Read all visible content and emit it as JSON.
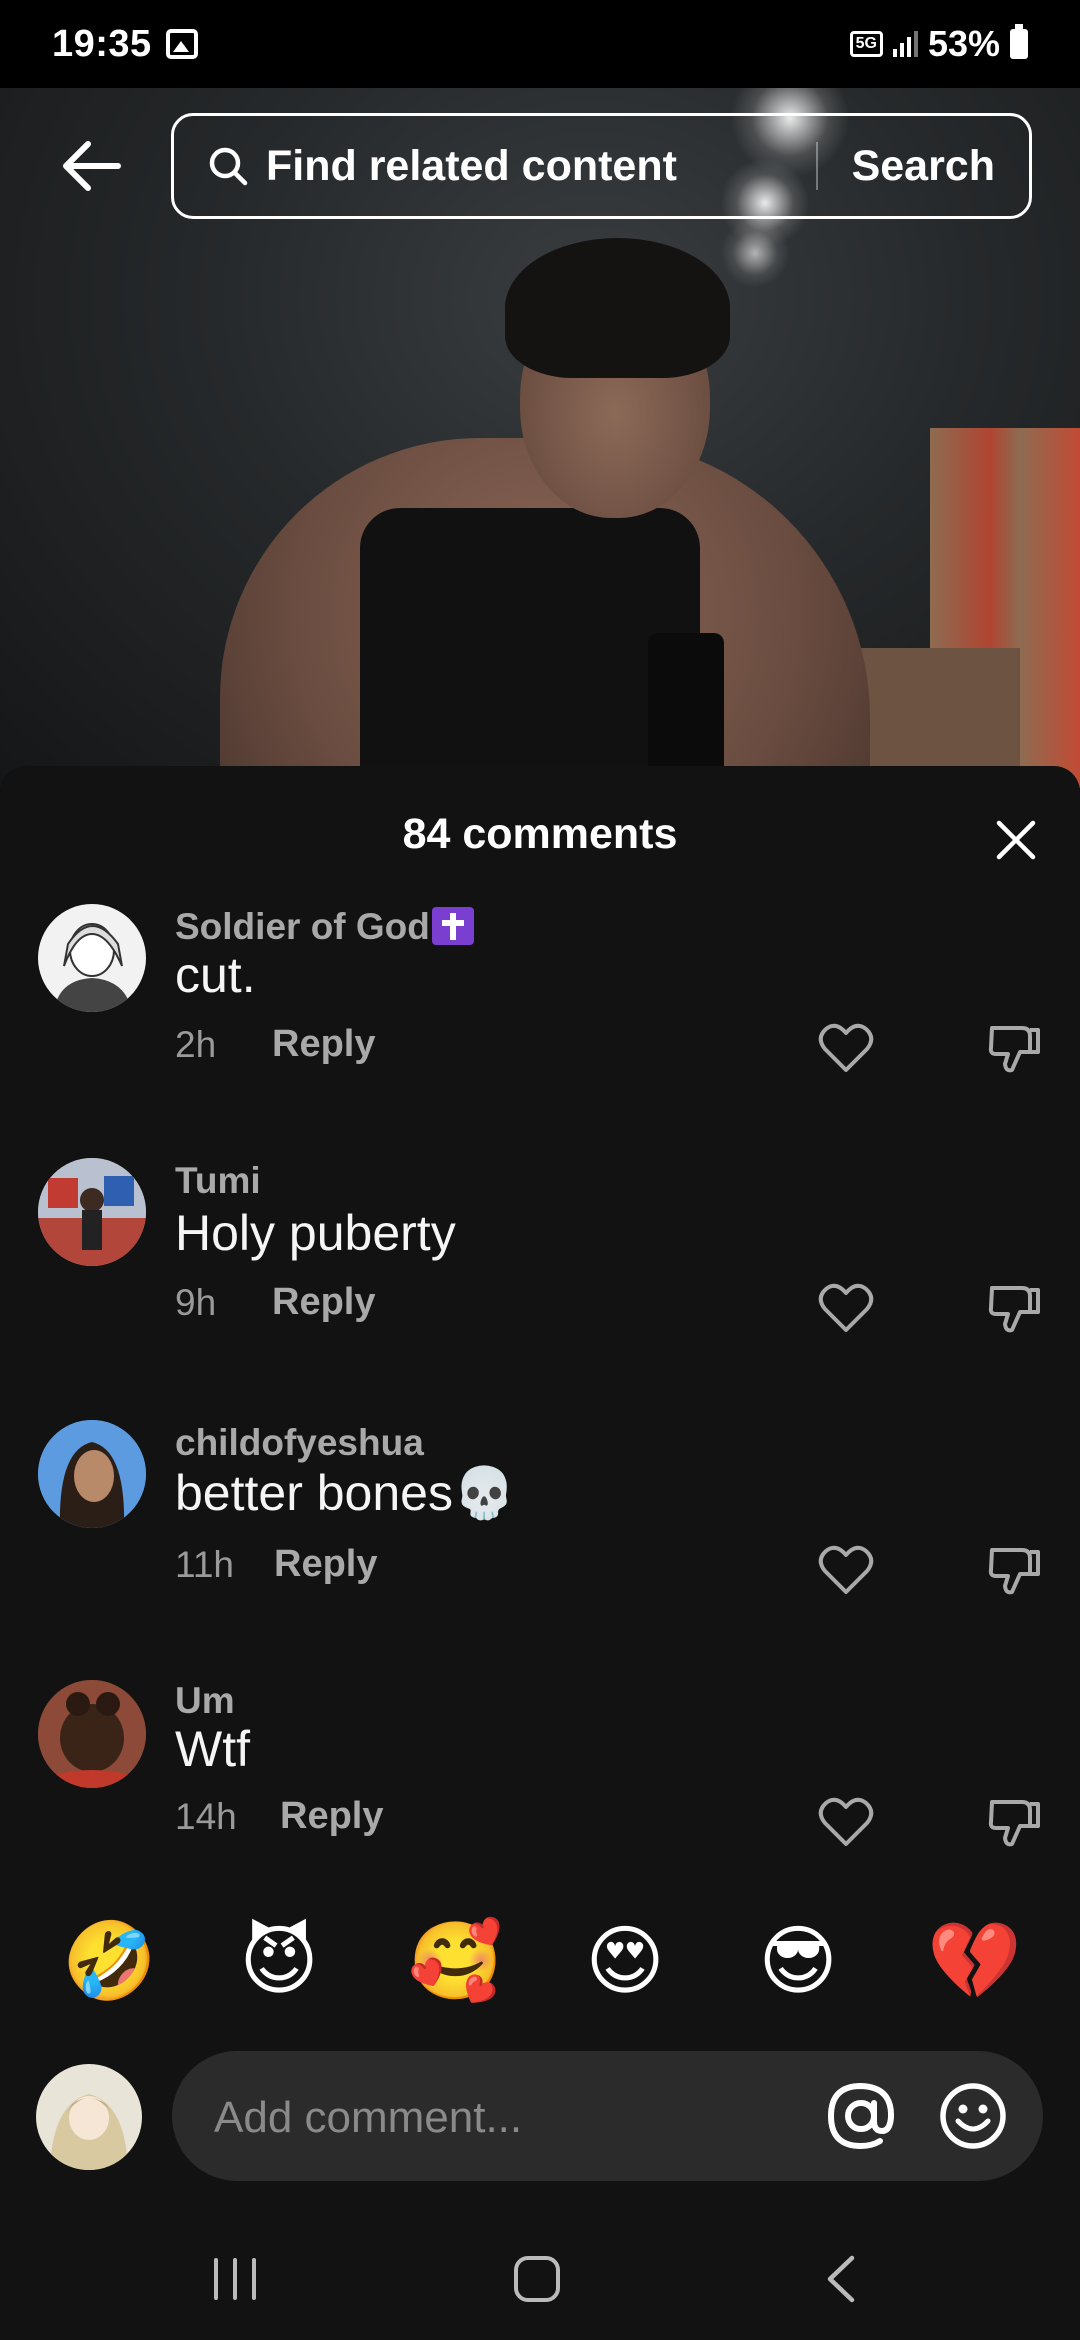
{
  "status_bar": {
    "time": "19:35",
    "network": "5G",
    "battery": "53%",
    "icons": [
      "gallery-icon",
      "signal-icon",
      "battery-icon"
    ]
  },
  "search": {
    "placeholder": "Find related content",
    "button_label": "Search"
  },
  "comments_sheet": {
    "title": "84 comments",
    "comments": [
      {
        "username": "Soldier of God",
        "badge": "latin-cross-emoji",
        "text": "cut.",
        "time": "2h",
        "reply_label": "Reply"
      },
      {
        "username": "Tumi",
        "text": "Holy puberty",
        "time": "9h",
        "reply_label": "Reply"
      },
      {
        "username": "childofyeshua",
        "text": "better bones💀",
        "time": "11h",
        "reply_label": "Reply"
      },
      {
        "username": "Um",
        "text": "Wtf",
        "time": "14h",
        "reply_label": "Reply"
      }
    ]
  },
  "quick_emojis": [
    "🤣",
    "😈",
    "🥰",
    "😍",
    "😎",
    "💔"
  ],
  "composer": {
    "placeholder": "Add comment..."
  },
  "colors": {
    "sheet_background": "#121212",
    "input_background": "#2b2b2b",
    "secondary_text": "#a9a9a9",
    "badge_purple": "#7a3fd0"
  }
}
